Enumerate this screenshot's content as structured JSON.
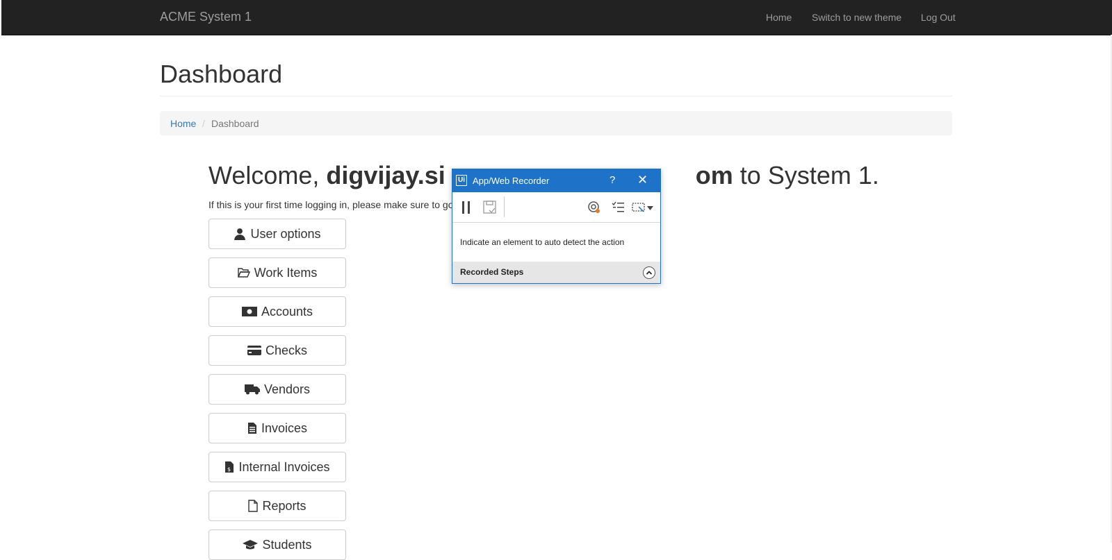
{
  "navbar": {
    "brand": "ACME System 1",
    "links": [
      "Home",
      "Switch to new theme",
      "Log Out"
    ]
  },
  "page": {
    "title": "Dashboard",
    "breadcrumb": {
      "home": "Home",
      "separator": "/",
      "current": "Dashboard"
    }
  },
  "welcome": {
    "prefix": "Welcome, ",
    "user_visible_1": "digvijay.si",
    "user_visible_2": "om",
    "suffix": " to System 1.",
    "hint": "If this is your first time logging in, please make sure to go"
  },
  "buttons": [
    {
      "label": "User options",
      "icon": "user-icon"
    },
    {
      "label": "Work Items",
      "icon": "folder-open-icon"
    },
    {
      "label": "Accounts",
      "icon": "money-icon"
    },
    {
      "label": "Checks",
      "icon": "credit-card-icon"
    },
    {
      "label": "Vendors",
      "icon": "truck-icon"
    },
    {
      "label": "Invoices",
      "icon": "invoice-icon"
    },
    {
      "label": "Internal Invoices",
      "icon": "invoice-dollar-icon"
    },
    {
      "label": "Reports",
      "icon": "file-icon"
    },
    {
      "label": "Students",
      "icon": "graduation-cap-icon"
    }
  ],
  "recorder": {
    "title": "App/Web Recorder",
    "logo": "Ui",
    "help": "?",
    "close": "✕",
    "message": "Indicate an element to auto detect the action",
    "steps_label": "Recorded Steps"
  },
  "colors": {
    "navbar_bg": "#222222",
    "link_blue": "#337ab7",
    "recorder_blue": "#1e73c8"
  }
}
